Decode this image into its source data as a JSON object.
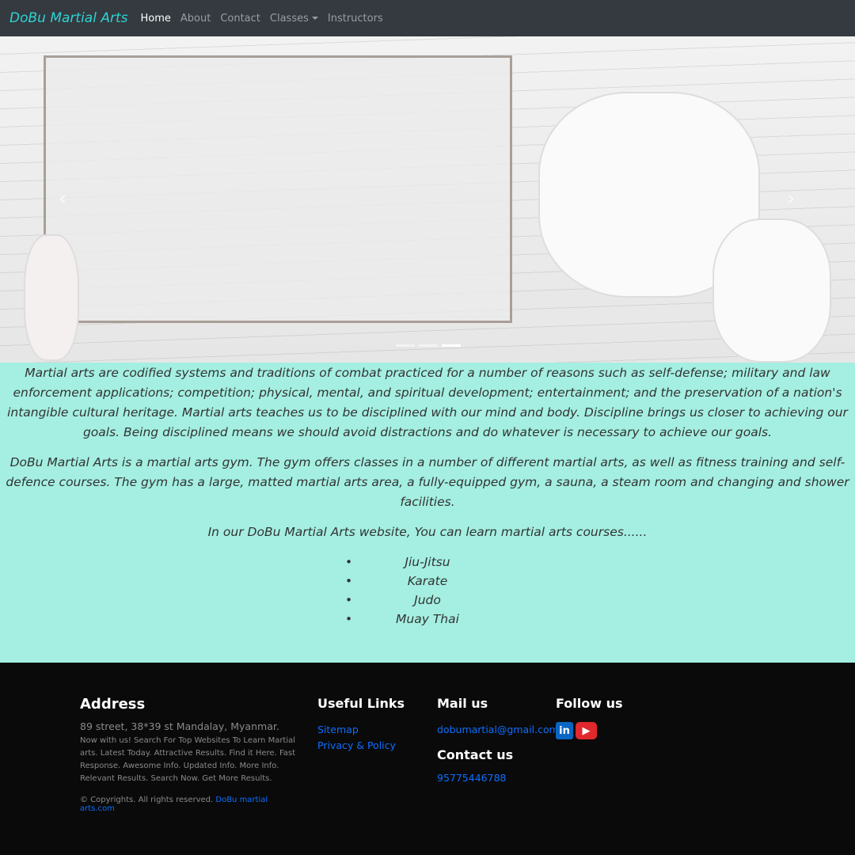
{
  "nav": {
    "brand": "DoBu Martial Arts",
    "items": [
      "Home",
      "About",
      "Contact",
      "Classes",
      "Instructors"
    ]
  },
  "carousel": {
    "prev_icon": "chevron-left-icon",
    "next_icon": "chevron-right-icon",
    "slides": 3,
    "active_slide": 3
  },
  "main": {
    "paragraphs": [
      "Martial arts are codified systems and traditions of combat practiced for a number of reasons such as self-defense; military and law enforcement applications; competition; physical, mental, and spiritual development; entertainment; and the preservation of a nation's intangible cultural heritage. Martial arts teaches us to be disciplined with our mind and body. Discipline brings us closer to achieving our goals. Being disciplined means we should avoid distractions and do whatever is necessary to achieve our goals.",
      "DoBu Martial Arts is a martial arts gym. The gym offers classes in a number of different martial arts, as well as fitness training and self-defence courses. The gym has a large, matted martial arts area, a fully-equipped gym, a sauna, a steam room and changing and shower facilities.",
      "In our DoBu Martial Arts website, You can learn martial arts courses......"
    ],
    "courses": [
      "Jiu-Jitsu",
      "Karate",
      "Judo",
      "Muay Thai"
    ]
  },
  "footer": {
    "address": {
      "title": "Address",
      "line": "89 street, 38*39 st Mandalay, Myanmar.",
      "desc": "Now with us! Search For Top Websites To Learn Martial arts. Latest Today. Attractive Results. Find it Here. Fast Response. Awesome Info. Updated Info. More Info. Relevant Results. Search Now. Get More Results.",
      "copyright": "© Copyrights. All rights reserved.",
      "copyright_link": "DoBu martial arts.com"
    },
    "links": {
      "title": "Useful Links",
      "items": [
        "Sitemap",
        "Privacy & Policy"
      ]
    },
    "mail": {
      "title": "Mail us",
      "email": "dobumartial@gmail.com",
      "contact_title": "Contact us",
      "phone": "95775446788"
    },
    "follow": {
      "title": "Follow us",
      "linkedin_label": "in",
      "colors": {
        "linkedin": "#0a66c2",
        "youtube": "#e0282d"
      }
    }
  },
  "colors": {
    "nav_bg": "#343a40",
    "brand": "#2ed3d3",
    "main_bg": "#a4efe2",
    "footer_bg": "#0a0a0a",
    "link": "#0d6efd"
  }
}
